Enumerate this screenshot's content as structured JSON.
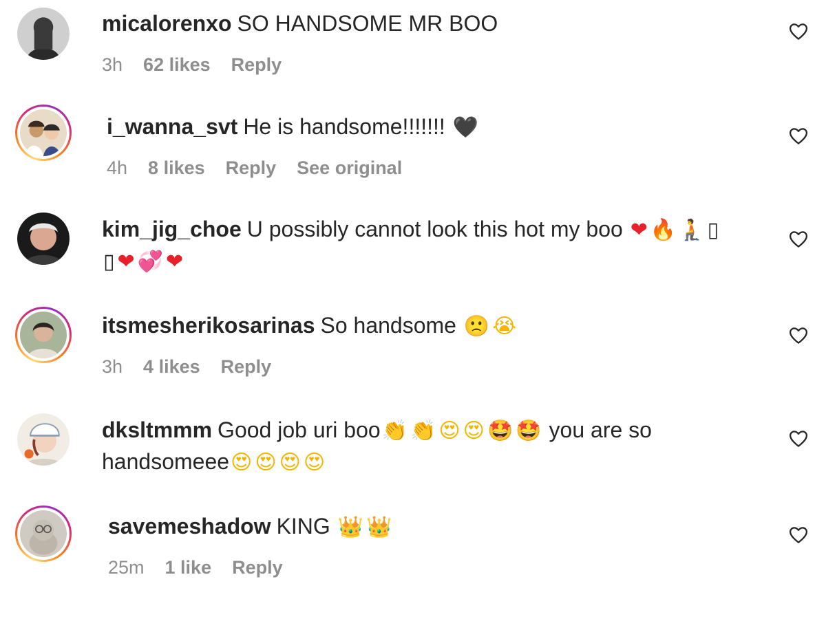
{
  "comments": [
    {
      "username": "micalorenxo",
      "text": "SO HANDSOME MR BOO",
      "time": "3h",
      "likes": "62 likes",
      "reply": "Reply",
      "story_ring": false,
      "heart_icon": "heart-outline-icon"
    },
    {
      "username": "i_wanna_svt",
      "text": "He is handsome!!!!!!!",
      "emoji": [
        "🖤"
      ],
      "time": "4h",
      "likes": "8 likes",
      "reply": "Reply",
      "see_original": "See original",
      "story_ring": true,
      "heart_icon": "heart-outline-icon"
    },
    {
      "username": "kim_jig_choe",
      "text": "U possibly cannot look this hot my boo",
      "emoji_line1": [
        "❤",
        "🔥",
        "🧎",
        "▯"
      ],
      "emoji_line2": [
        "▯",
        "❤",
        "💞",
        "❤"
      ],
      "story_ring": false,
      "heart_icon": "heart-outline-icon"
    },
    {
      "username": "itsmesherikosarinas",
      "text": "So handsome",
      "emoji": [
        "🙁",
        "😭"
      ],
      "time": "3h",
      "likes": "4 likes",
      "reply": "Reply",
      "story_ring": true,
      "heart_icon": "heart-outline-icon"
    },
    {
      "username": "dksltmmm",
      "text": "Good job uri boo",
      "emoji_line1": [
        "👏",
        "👏",
        "😍",
        "😍",
        "🤩",
        "🤩"
      ],
      "text_line1_tail": "you are so",
      "text_line2": "handsomeee",
      "emoji_line2": [
        "😍",
        "😍",
        "😍",
        "😍"
      ],
      "story_ring": false,
      "heart_icon": "heart-outline-icon"
    },
    {
      "username": "savemeshadow",
      "text": "KING",
      "emoji": [
        "👑",
        "👑"
      ],
      "time": "25m",
      "likes": "1 like",
      "reply": "Reply",
      "story_ring": true,
      "heart_icon": "heart-outline-icon"
    }
  ],
  "colors": {
    "text": "#262626",
    "meta": "#8e8e8e",
    "story_ring": [
      "#feda75",
      "#fa7e1e",
      "#d62976",
      "#962fbf"
    ]
  }
}
